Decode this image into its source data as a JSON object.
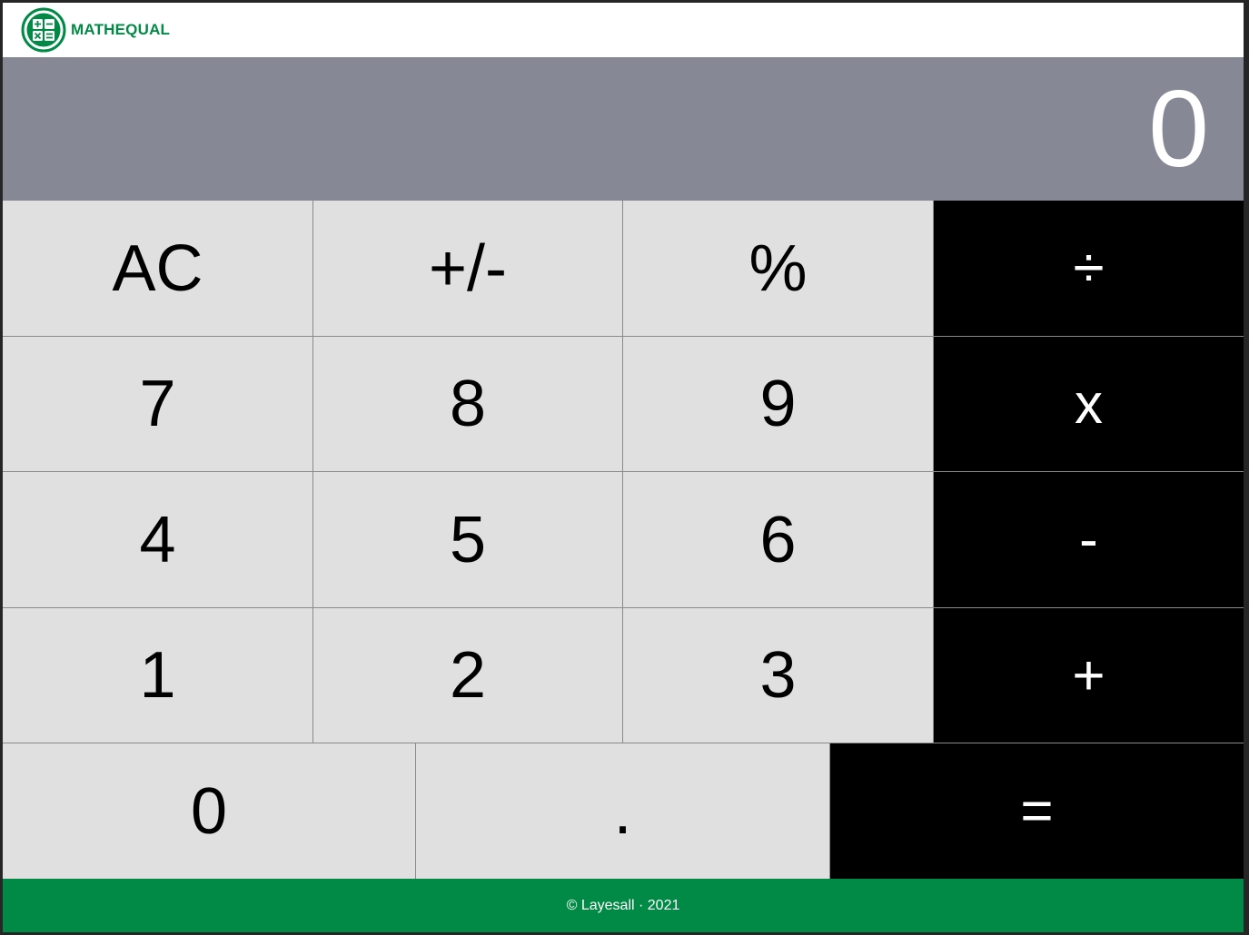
{
  "brand": {
    "name": "MATHEQUAL",
    "logo_icon": "calculator-icon",
    "color": "#008a45"
  },
  "display": {
    "value": "0",
    "background": "#878895"
  },
  "keys": {
    "clear": "AC",
    "sign": "+/-",
    "percent": "%",
    "divide": "÷",
    "seven": "7",
    "eight": "8",
    "nine": "9",
    "multiply": "x",
    "four": "4",
    "five": "5",
    "six": "6",
    "subtract": "-",
    "one": "1",
    "two": "2",
    "three": "3",
    "add": "+",
    "zero": "0",
    "decimal": ".",
    "equals": "="
  },
  "footer": {
    "text": "© Layesall · 2021",
    "background": "#008a45"
  }
}
